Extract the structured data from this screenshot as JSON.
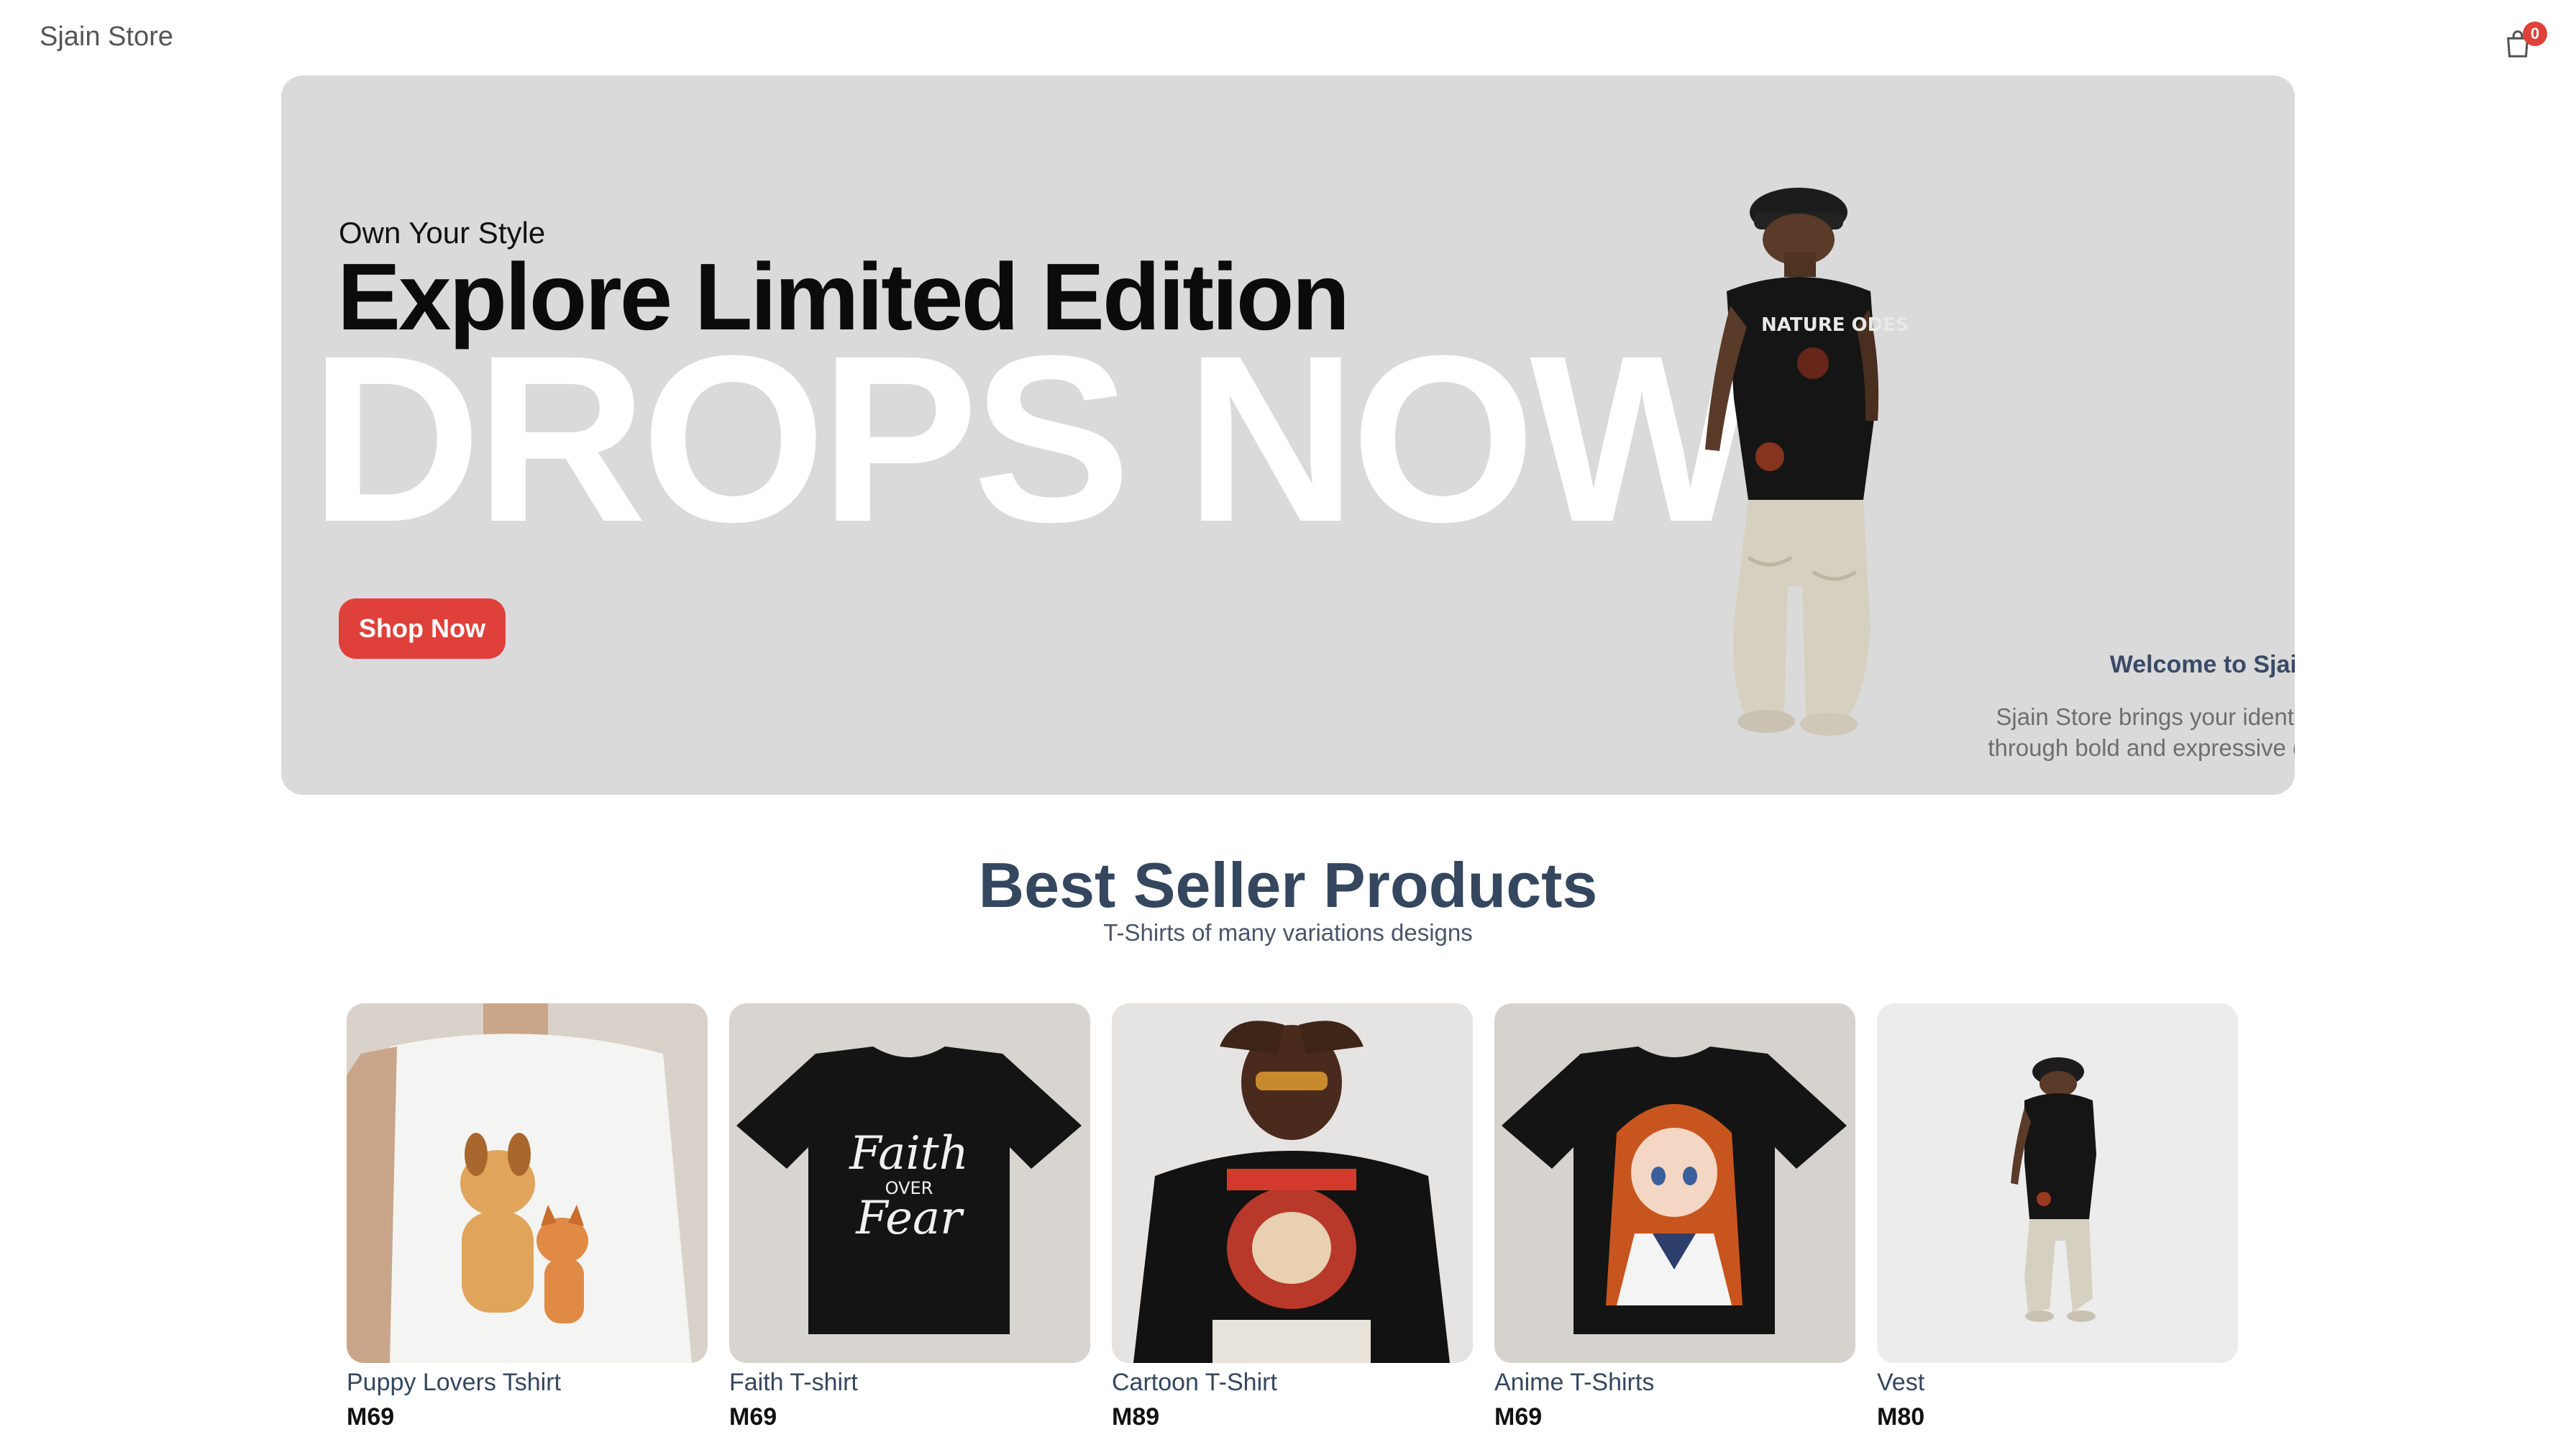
{
  "header": {
    "brand": "Sjain Store",
    "cart_count": "0"
  },
  "hero": {
    "tagline": "Own Your Style",
    "title": "Explore Limited Edition",
    "big_text": "DROPS NOW",
    "cta_label": "Shop Now",
    "welcome_title": "Welcome to Sjain Store",
    "welcome_line1": "Sjain Store brings your identity to life",
    "welcome_line2": "through bold and expressive designs.",
    "shirt_print": "NATURE ODES"
  },
  "section": {
    "title": "Best Seller Products",
    "subtitle": "T-Shirts of many variations designs"
  },
  "products": [
    {
      "name": "Puppy Lovers Tshirt",
      "price": "M69"
    },
    {
      "name": "Faith T-shirt",
      "price": "M69",
      "print_line1": "Faith",
      "print_line2": "OVER",
      "print_line3": "Fear"
    },
    {
      "name": "Cartoon T-Shirt",
      "price": "M89"
    },
    {
      "name": "Anime T-Shirts",
      "price": "M69"
    },
    {
      "name": "Vest",
      "price": "M80"
    }
  ],
  "colors": {
    "accent": "#e0403a",
    "hero_bg": "#dadadb",
    "heading": "#34475f"
  }
}
